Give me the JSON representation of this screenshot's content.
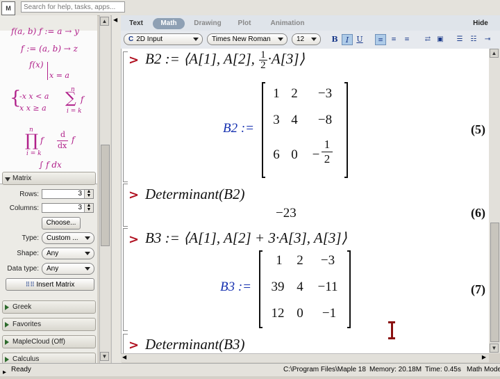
{
  "top": {
    "search_placeholder": "Search for help, tasks, apps..."
  },
  "palette": {
    "expressions": {
      "row0": "f(a, b) ƒ := a → y",
      "row1": "f := (a, b) → z",
      "row2_a": "f(x)",
      "row2_b": "x = a",
      "pw_top": "-x   x < a",
      "pw_bot": "x    x ≥ a",
      "sum_sym": "∑",
      "sum_top": "n",
      "sum_bot": "i = k",
      "sum_f": "f",
      "prod_sym": "∏",
      "prod_top": "n",
      "prod_bot": "i = k",
      "prod_f": "f",
      "deriv_num": "d",
      "deriv_den": "dx",
      "deriv_f": "f",
      "int": "∫ f dx"
    },
    "matrix": {
      "title": "Matrix",
      "rows_label": "Rows:",
      "rows_value": "3",
      "cols_label": "Columns:",
      "cols_value": "3",
      "choose_label": "Choose...",
      "type_label": "Type:",
      "type_value": "Custom ...",
      "shape_label": "Shape:",
      "shape_value": "Any",
      "dtype_label": "Data type:",
      "dtype_value": "Any",
      "insert_label": "Insert Matrix"
    },
    "sections": [
      "Greek",
      "Favorites",
      "MapleCloud (Off)",
      "Calculus"
    ]
  },
  "toolbar": {
    "tabs": [
      "Text",
      "Math",
      "Drawing",
      "Plot",
      "Animation"
    ],
    "active_tab": "Math",
    "hide_label": "Hide",
    "input_mode": "2D Input",
    "input_mode_icon": "C",
    "font": "Times New Roman",
    "size": "12",
    "bold": "B",
    "italic": "I",
    "underline": "U"
  },
  "document": {
    "b2_input_prefix": "B2 := ⟨A[1], A[2], ",
    "b2_frac_num": "1",
    "b2_frac_den": "2",
    "b2_input_suffix": "·A[3]⟩",
    "b2_name": "B2 :=",
    "b2_matrix": [
      [
        "1",
        "2",
        "−3"
      ],
      [
        "3",
        "4",
        "−8"
      ],
      [
        "6",
        "0",
        "−"
      ]
    ],
    "b2_frac_cell_num": "1",
    "b2_frac_cell_den": "2",
    "eq5": "(5)",
    "det_b2_input": "Determinant(B2)",
    "det_b2_value": "−23",
    "eq6": "(6)",
    "b3_input": "B3 := ⟨A[1], A[2] + 3·A[3], A[3]⟩",
    "b3_name": "B3 :=",
    "b3_matrix": [
      [
        "1",
        "2",
        "−3"
      ],
      [
        "39",
        "4",
        "−11"
      ],
      [
        "12",
        "0",
        "−1"
      ]
    ],
    "eq7": "(7)",
    "det_b3_input": "Determinant(B3)",
    "prompt": ">"
  },
  "status": {
    "ready": "Ready",
    "path": "C:\\Program Files\\Maple 18",
    "memory": "Memory: 20.18M",
    "time": "Time: 0.45s",
    "mode": "Math Mode"
  }
}
